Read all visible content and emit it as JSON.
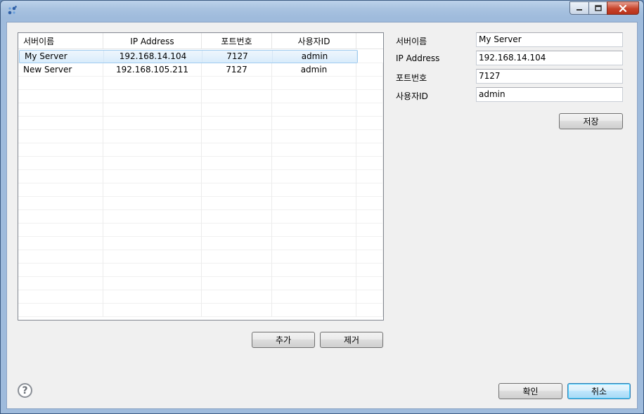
{
  "window": {
    "icon": "app-icon",
    "caption": {
      "minimize": "minimize-icon",
      "maximize": "maximize-icon",
      "close": "close-icon"
    }
  },
  "table": {
    "headers": [
      "서버이름",
      "IP Address",
      "포트번호",
      "사용자ID",
      ""
    ],
    "rows": [
      [
        "My Server",
        "192.168.14.104",
        "7127",
        "admin"
      ],
      [
        "New Server",
        "192.168.105.211",
        "7127",
        "admin"
      ]
    ],
    "selected_index": 0
  },
  "form": {
    "name_label": "서버이름",
    "name_value": "My Server",
    "ip_label": "IP Address",
    "ip_value": "192.168.14.104",
    "port_label": "포트번호",
    "port_value": "7127",
    "user_label": "사용자ID",
    "user_value": "admin",
    "save_label": "저장"
  },
  "buttons": {
    "add": "추가",
    "remove": "제거",
    "ok": "확인",
    "cancel": "취소"
  },
  "help_glyph": "?"
}
